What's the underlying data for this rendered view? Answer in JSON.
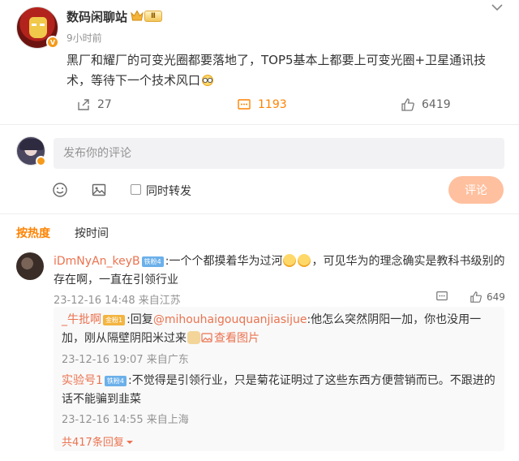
{
  "post": {
    "author": "数码闲聊站",
    "level": "Ⅱ",
    "time": "9小时前",
    "text": "黑厂和耀厂的可变光圈都要落地了，TOP5基本上都要上可变光圈+卫星通讯技术，等待下一个技术风口",
    "reposts": "27",
    "comments": "1193",
    "likes": "6419"
  },
  "composer": {
    "placeholder": "发布你的评论",
    "forward_label": "同时转发",
    "submit_label": "评论"
  },
  "sort": {
    "hot": "按热度",
    "time": "按时间"
  },
  "comments": [
    {
      "user": "iDmNyAn_keyB",
      "badge": "铁粉4",
      "text_a": ":一个个都摸着华为过河",
      "text_b": "，可见华为的理念确实是教科书级别的存在啊，一直在引领行业",
      "meta": "23-12-16 14:48 来自江苏",
      "likes": "649"
    }
  ],
  "replies": [
    {
      "user": "_牛批啊",
      "badge": "金粉1",
      "prefix": ":回复",
      "mention": "@mihouhaigouquanjiasijue",
      "text": ":他怎么突然阴阳一加，你也没用一加，刚从隔壁阴阳米过来",
      "view_image": "查看图片",
      "meta": "23-12-16 19:07 来自广东"
    },
    {
      "user": "实验号1",
      "badge": "铁粉4",
      "text": ":不觉得是引领行业，只是菊花证明过了这些东西方便营销而已。不跟进的话不能骗到韭菜",
      "meta": "23-12-16 14:55 来自上海"
    }
  ],
  "more_replies": "共417条回复",
  "colors": {
    "accent": "#ff8200",
    "link": "#eb7350",
    "muted": "#939393"
  }
}
